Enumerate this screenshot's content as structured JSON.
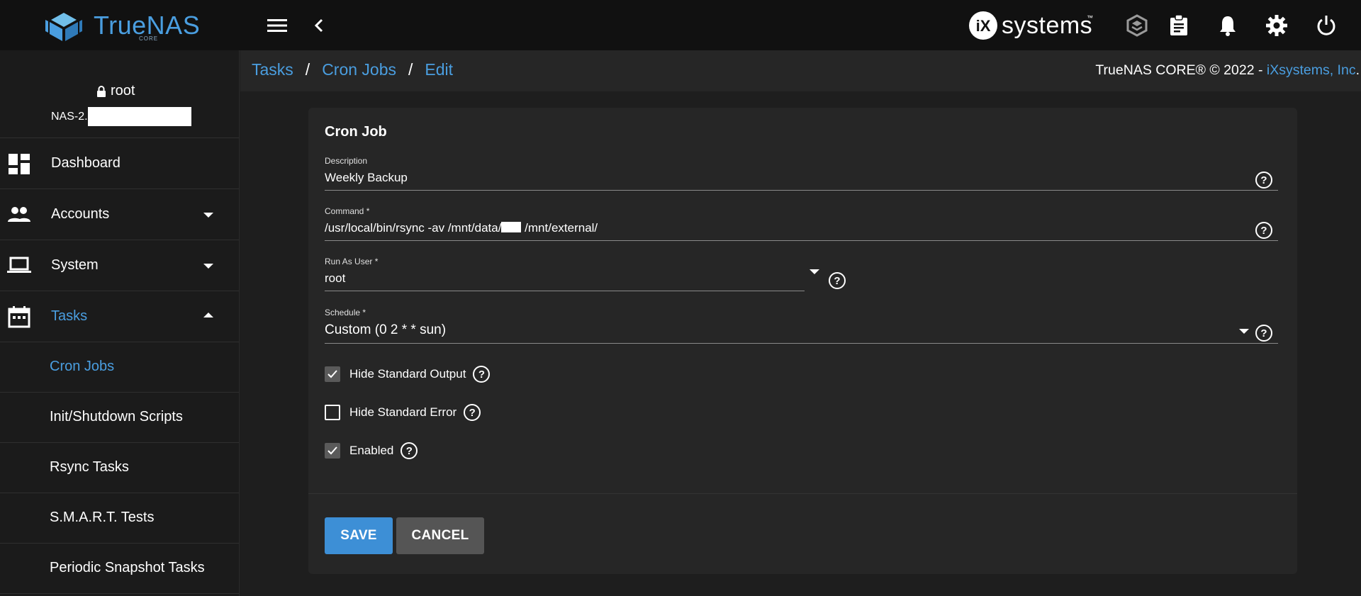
{
  "app": {
    "logo_text": "TrueNAS",
    "logo_subtext": "CORE",
    "vendor_logo_text": "systems",
    "vendor_logo_mark": "iX",
    "vendor_logo_tm": "™"
  },
  "user": {
    "name": "root",
    "hostname_prefix": "NAS-2."
  },
  "sidebar": {
    "items": [
      {
        "label": "Dashboard",
        "icon": "dashboard-icon"
      },
      {
        "label": "Accounts",
        "icon": "accounts-icon"
      },
      {
        "label": "System",
        "icon": "laptop-icon"
      },
      {
        "label": "Tasks",
        "icon": "calendar-icon"
      }
    ],
    "sub_items": [
      {
        "label": "Cron Jobs"
      },
      {
        "label": "Init/Shutdown Scripts"
      },
      {
        "label": "Rsync Tasks"
      },
      {
        "label": "S.M.A.R.T. Tests"
      },
      {
        "label": "Periodic Snapshot Tasks"
      }
    ]
  },
  "breadcrumb": {
    "items": [
      "Tasks",
      "Cron Jobs",
      "Edit"
    ]
  },
  "copyright": {
    "prefix": "TrueNAS CORE® © 2022 - ",
    "brand": "iXsystems, Inc",
    "suffix": "."
  },
  "form": {
    "title": "Cron Job",
    "description": {
      "label": "Description",
      "value": "Weekly Backup"
    },
    "command": {
      "label": "Command *",
      "value_before": "/usr/local/bin/rsync -av /mnt/data/",
      "value_after": " /mnt/external/"
    },
    "run_as_user": {
      "label": "Run As User *",
      "value": "root"
    },
    "schedule": {
      "label": "Schedule *",
      "value": "Custom (0 2 * * sun)"
    },
    "checkboxes": [
      {
        "label": "Hide Standard Output",
        "checked": true
      },
      {
        "label": "Hide Standard Error",
        "checked": false
      },
      {
        "label": "Enabled",
        "checked": true
      }
    ],
    "help_glyph": "?",
    "save_label": "SAVE",
    "cancel_label": "CANCEL"
  },
  "colors": {
    "accent": "#4a9ee0",
    "topbar": "#111111",
    "background": "#1e1e1e",
    "card": "#262626",
    "save_button": "#3d8fd6",
    "cancel_button": "#555555"
  }
}
